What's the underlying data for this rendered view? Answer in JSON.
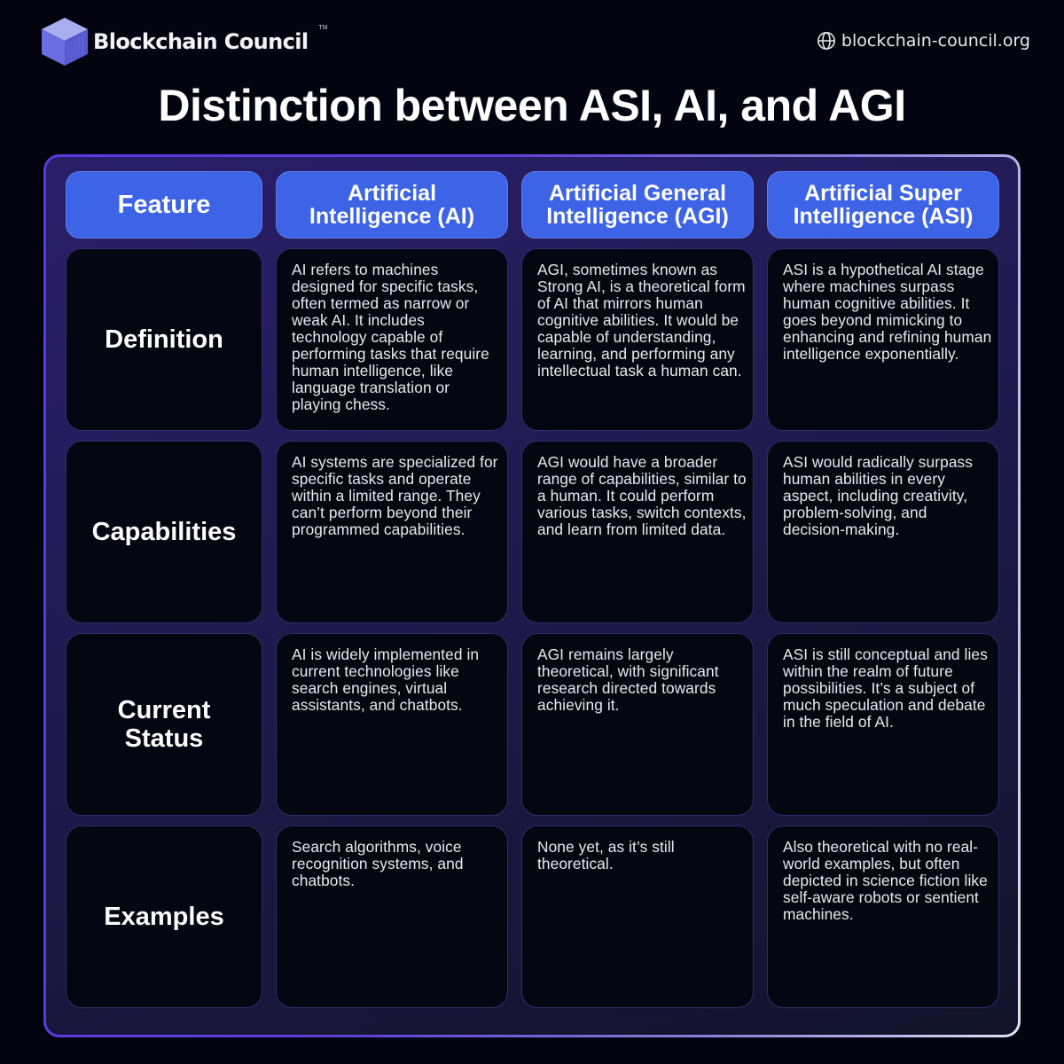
{
  "brand": {
    "name": "Blockchain Council",
    "trademark": "TM",
    "logo_icon": "cube-logo-icon"
  },
  "site": {
    "icon": "globe-icon",
    "url": "blockchain-council.org"
  },
  "title": "Distinction between ASI, AI, and AGI",
  "colors": {
    "background": "#03040f",
    "header_cell": "#3d63e6",
    "cell_background": "#040711",
    "frame_fill": "#221b55",
    "frame_border_start": "#5a3be0",
    "frame_border_end": "#dfe2f2"
  },
  "table": {
    "headers": [
      "Feature",
      "Artificial Intelligence (AI)",
      "Artificial General Intelligence (AGI)",
      "Artificial Super Intelligence (ASI)"
    ],
    "rows": [
      {
        "feature": "Definition",
        "ai": "AI refers to machines designed for specific tasks, often termed as narrow or weak AI. It includes technology capable of performing tasks that require human intelligence, like language translation or playing chess.",
        "agi": "AGI, sometimes known as Strong AI, is a theoretical form of AI that mirrors human cognitive abilities. It would be capable of understanding, learning, and performing any intellectual task a human can.",
        "asi": "ASI is a hypothetical AI stage where machines surpass human cognitive abilities. It goes beyond mimicking to enhancing and refining human intelligence exponentially."
      },
      {
        "feature": "Capabilities",
        "ai": "AI systems are specialized for specific tasks and operate within a limited range. They can’t perform beyond their programmed capabilities.",
        "agi": "AGI would have a broader range of capabilities, similar to a human. It could perform various tasks, switch contexts, and learn from limited data.",
        "asi": "ASI would radically surpass human abilities in every aspect, including creativity, problem-solving, and decision-making."
      },
      {
        "feature": "Current Status",
        "ai": "AI is widely implemented in current technologies like search engines, virtual assistants, and chatbots.",
        "agi": "AGI remains largely theoretical, with significant research directed towards achieving it.",
        "asi": "ASI is still conceptual and lies within the realm of future possibilities. It’s a subject of much speculation and debate in the field of AI."
      },
      {
        "feature": "Examples",
        "ai": "Search algorithms, voice recognition systems, and chatbots.",
        "agi": "None yet, as it’s still theoretical.",
        "asi": "Also theoretical with no real-world examples, but often depicted in science fiction like self-aware robots or sentient machines."
      }
    ]
  }
}
